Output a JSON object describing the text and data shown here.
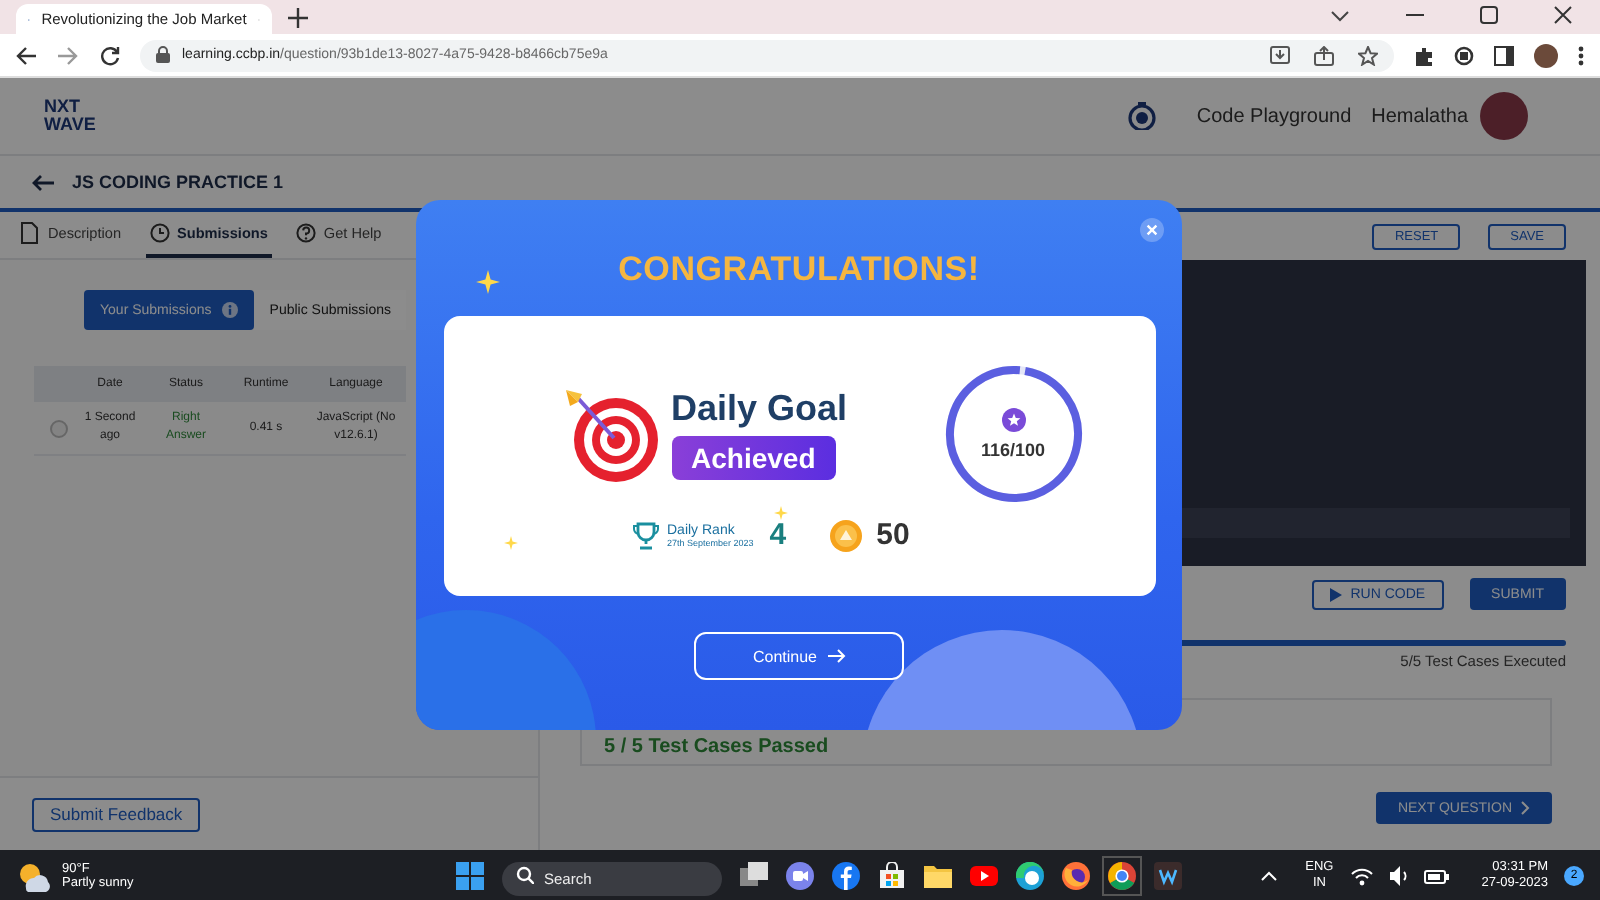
{
  "browser": {
    "tab_title": "Revolutionizing the Job Market",
    "url_host": "learning.ccbp.in",
    "url_path": "/question/93b1de13-8027-4a75-9428-b8466cb75e9a"
  },
  "header": {
    "logo": [
      "NXT",
      "WAVE"
    ],
    "link": "Code Playground",
    "user": "Hemalatha"
  },
  "breadcrumb": "JS CODING PRACTICE 1",
  "tabs": [
    {
      "label": "Description",
      "kind": "doc",
      "selected": false
    },
    {
      "label": "Submissions",
      "kind": "clock",
      "selected": true
    },
    {
      "label": "Get Help",
      "kind": "help",
      "selected": false
    }
  ],
  "submission_toggle": [
    {
      "label": "Your Submissions",
      "selected": true
    },
    {
      "label": "Public Submissions",
      "selected": false
    }
  ],
  "table": {
    "columns": [
      "Date",
      "Status",
      "Runtime",
      "Language"
    ],
    "rows": [
      {
        "date": "1 Second ago",
        "status": "Right Answer",
        "runtime": "0.41 s",
        "language": "JavaScript (No",
        "language_version": "v12.6.1)",
        "selected": false
      }
    ]
  },
  "feedback_button": "Submit Feedback",
  "editor_buttons": [
    "RESET",
    "SAVE"
  ],
  "run_button": "RUN CODE",
  "submit_button": "SUBMIT",
  "progress": {
    "level": 1,
    "caption": "5/5 Test Cases Executed"
  },
  "result": "5 / 5 Test Cases Passed",
  "next_button": "NEXT QUESTION",
  "modal": {
    "title": "CONGRATULATIONS!",
    "heading": "Daily Goal",
    "badge": "Achieved",
    "ring": {
      "level": 1,
      "reading": "116/100"
    },
    "rank": {
      "label": "Daily Rank",
      "date": "27th September 2023",
      "value": "4"
    },
    "coins": "50",
    "button": "Continue"
  },
  "taskbar": {
    "temperature": "90°F",
    "weather": "Partly sunny",
    "search": {
      "placeholder": "Search"
    },
    "language": [
      "ENG",
      "IN"
    ],
    "time": "03:31 PM",
    "date": "27-09-2023",
    "notifications": "2"
  }
}
